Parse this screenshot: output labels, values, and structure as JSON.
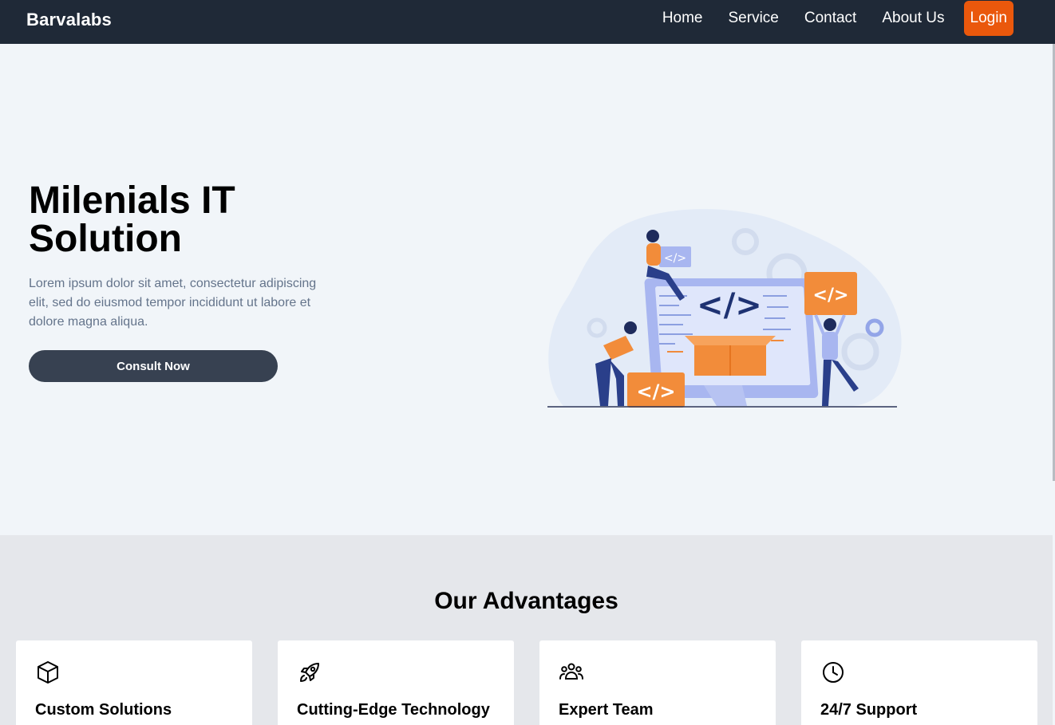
{
  "nav": {
    "brand": "Barvalabs",
    "links": [
      "Home",
      "Service",
      "Contact",
      "About Us"
    ],
    "login_label": "Login"
  },
  "hero": {
    "title": "Milenials IT Solution",
    "description": "Lorem ipsum dolor sit amet, consectetur adipiscing elit, sed do eiusmod tempor incididunt ut labore et dolore magna aliqua.",
    "cta_label": "Consult Now",
    "illustration_icon": "code-illustration"
  },
  "advantages": {
    "title": "Our Advantages",
    "cards": [
      {
        "icon": "cube-icon",
        "title": "Custom Solutions"
      },
      {
        "icon": "rocket-icon",
        "title": "Cutting-Edge Technology"
      },
      {
        "icon": "team-icon",
        "title": "Expert Team"
      },
      {
        "icon": "clock-icon",
        "title": "24/7 Support"
      }
    ]
  },
  "colors": {
    "navbar": "#1f2937",
    "accent": "#ea580c",
    "button": "#374151",
    "hero_bg": "#f1f5f9",
    "section_bg": "#e5e7eb"
  }
}
